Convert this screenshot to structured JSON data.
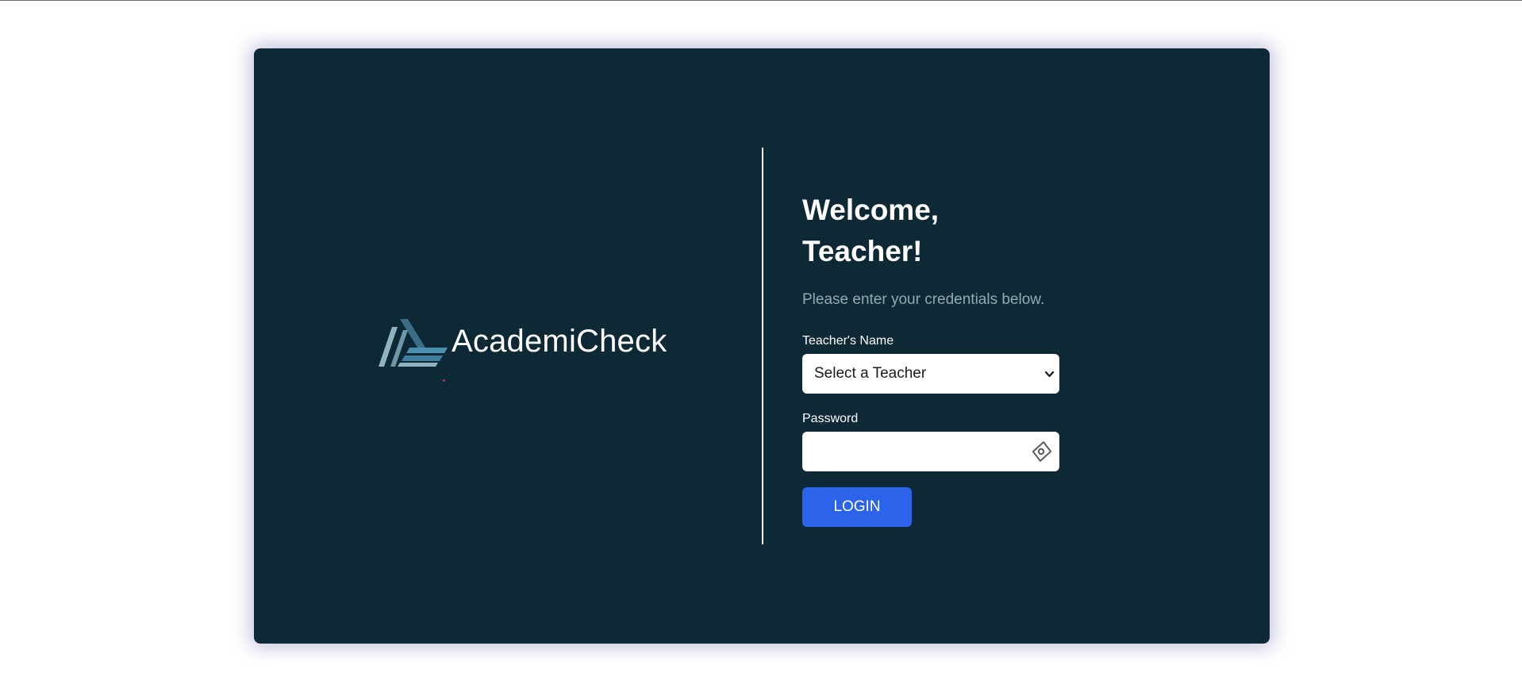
{
  "brand": {
    "name": "AcademiCheck",
    "logo_icon": "stacked-triangle-logo",
    "logo_colors": [
      "#3b6d86",
      "#4a8fae",
      "#8fb3c3"
    ]
  },
  "form": {
    "welcome": "Welcome, Teacher!",
    "subtitle": "Please enter your credentials below.",
    "teacher_label": "Teacher's Name",
    "teacher_select_value": "Select a Teacher",
    "password_label": "Password",
    "password_value": "",
    "password_toggle_icon": "eye-icon",
    "login_label": "LOGIN"
  },
  "colors": {
    "page_background": "#ffffff",
    "card_background": "#0d2935",
    "accent_button": "#2b64ea",
    "subtitle_text": "#93a9b4",
    "divider": "#ffffff"
  }
}
